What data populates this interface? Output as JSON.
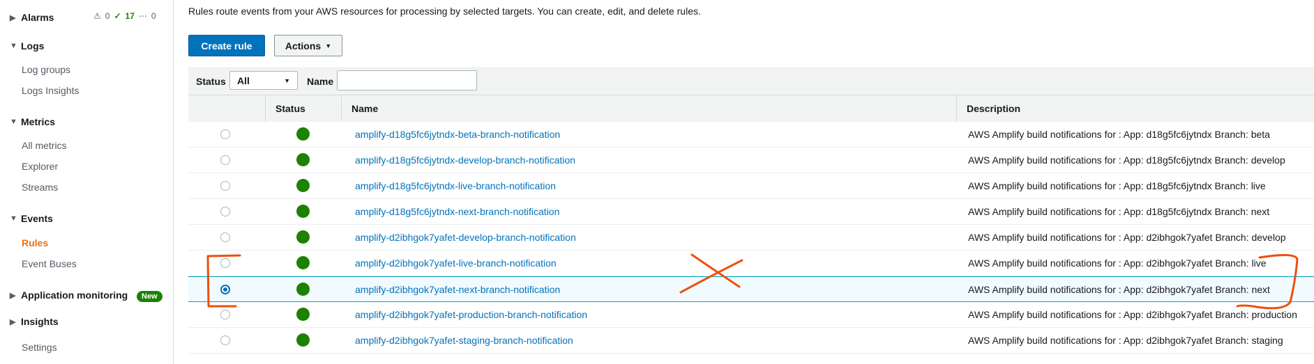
{
  "sidebar": {
    "alarms": {
      "label": "Alarms",
      "alarm_count": "0",
      "ok_count": "17",
      "insufficient_count": "0"
    },
    "logs": {
      "label": "Logs",
      "items": [
        "Log groups",
        "Logs Insights"
      ]
    },
    "metrics": {
      "label": "Metrics",
      "items": [
        "All metrics",
        "Explorer",
        "Streams"
      ]
    },
    "events": {
      "label": "Events",
      "items": [
        "Rules",
        "Event Buses"
      ]
    },
    "application_monitoring": {
      "label": "Application monitoring",
      "badge": "New"
    },
    "insights": {
      "label": "Insights"
    },
    "settings": "Settings"
  },
  "main": {
    "intro": "Rules route events from your AWS resources for processing by selected targets. You can create, edit, and delete rules.",
    "create_rule": "Create rule",
    "actions": "Actions",
    "filter": {
      "status_label": "Status",
      "status_value": "All",
      "name_label": "Name",
      "name_value": ""
    },
    "columns": {
      "status": "Status",
      "name": "Name",
      "description": "Description"
    },
    "rows": [
      {
        "name": "amplify-d18g5fc6jytndx-beta-branch-notification",
        "description": "AWS Amplify build notifications for : App: d18g5fc6jytndx Branch: beta",
        "selected": false
      },
      {
        "name": "amplify-d18g5fc6jytndx-develop-branch-notification",
        "description": "AWS Amplify build notifications for : App: d18g5fc6jytndx Branch: develop",
        "selected": false
      },
      {
        "name": "amplify-d18g5fc6jytndx-live-branch-notification",
        "description": "AWS Amplify build notifications for : App: d18g5fc6jytndx Branch: live",
        "selected": false
      },
      {
        "name": "amplify-d18g5fc6jytndx-next-branch-notification",
        "description": "AWS Amplify build notifications for : App: d18g5fc6jytndx Branch: next",
        "selected": false
      },
      {
        "name": "amplify-d2ibhgok7yafet-develop-branch-notification",
        "description": "AWS Amplify build notifications for : App: d2ibhgok7yafet Branch: develop",
        "selected": false
      },
      {
        "name": "amplify-d2ibhgok7yafet-live-branch-notification",
        "description": "AWS Amplify build notifications for : App: d2ibhgok7yafet Branch: live",
        "selected": false
      },
      {
        "name": "amplify-d2ibhgok7yafet-next-branch-notification",
        "description": "AWS Amplify build notifications for : App: d2ibhgok7yafet Branch: next",
        "selected": true
      },
      {
        "name": "amplify-d2ibhgok7yafet-production-branch-notification",
        "description": "AWS Amplify build notifications for : App: d2ibhgok7yafet Branch: production",
        "selected": false
      },
      {
        "name": "amplify-d2ibhgok7yafet-staging-branch-notification",
        "description": "AWS Amplify build notifications for : App: d2ibhgok7yafet Branch: staging",
        "selected": false
      }
    ]
  },
  "colors": {
    "primary": "#0073bb",
    "status_enabled": "#1d8102",
    "active_nav": "#ec7211",
    "annotation": "#f04e0c"
  }
}
